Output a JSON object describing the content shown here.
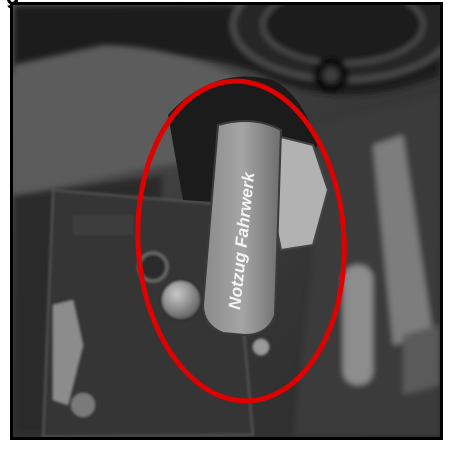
{
  "image": {
    "caption_fragment": "g",
    "lever_label": "Notzug Fahrwerk",
    "highlight": {
      "shape": "ellipse",
      "color": "#e00000"
    }
  },
  "colors": {
    "highlight": "#e00000",
    "frame": "#000000"
  }
}
